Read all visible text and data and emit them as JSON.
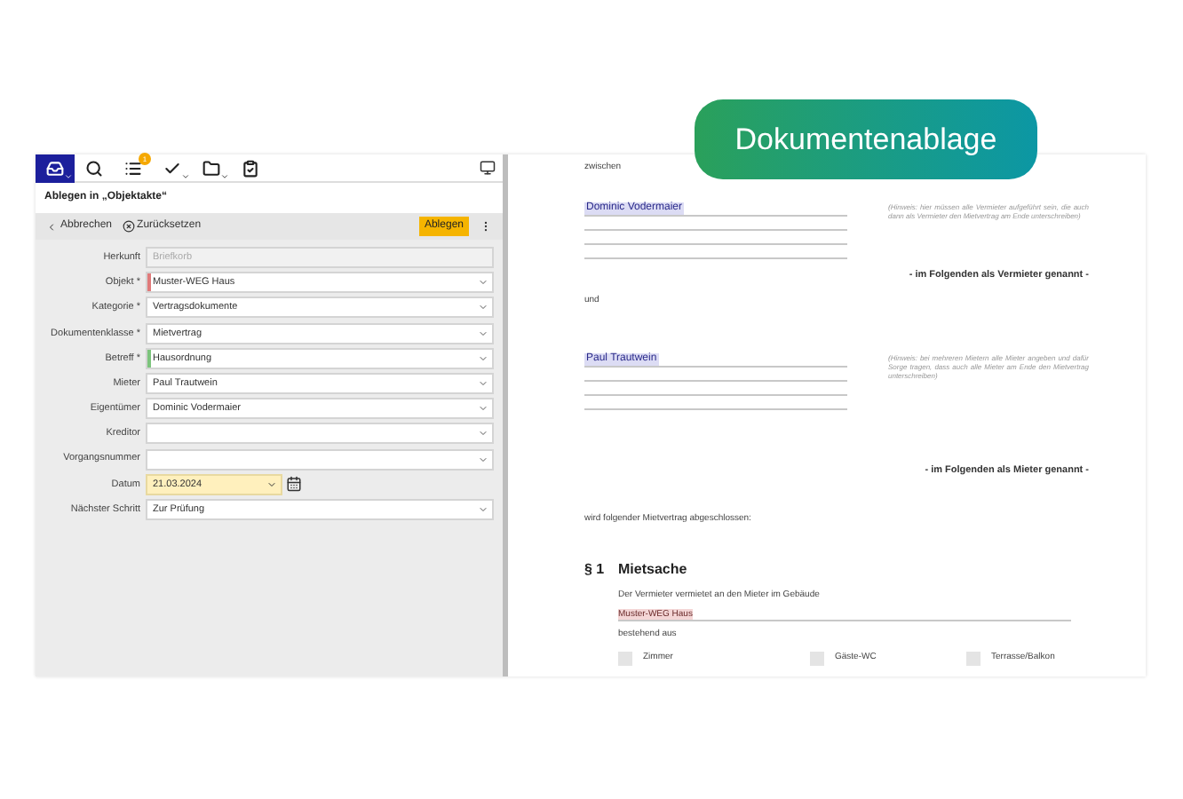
{
  "badge": "Dokumentenablage",
  "toolbar": [
    {
      "kind": "inbox",
      "selected": true,
      "caret": true
    },
    {
      "kind": "search",
      "selected": false,
      "caret": false
    },
    {
      "kind": "list",
      "selected": false,
      "caret": false,
      "count": "1"
    },
    {
      "kind": "check",
      "selected": false,
      "caret": true
    },
    {
      "kind": "folder",
      "selected": false,
      "caret": true
    },
    {
      "kind": "clipboard",
      "selected": false,
      "caret": false
    }
  ],
  "panel_title": "Ablegen in „Objektakte“",
  "actions": {
    "cancel": "Abbrechen",
    "reset": "Zurücksetzen",
    "submit": "Ablegen"
  },
  "fields": [
    {
      "label": "Herkunft",
      "kind": "readonly",
      "value": "Briefkorb"
    },
    {
      "label": "Objekt *",
      "kind": "select",
      "value": "Muster-WEG Haus",
      "color": "#e07a7a"
    },
    {
      "label": "Kategorie *",
      "kind": "select",
      "value": "Vertragsdokumente"
    },
    {
      "label": "Dokumentenklasse *",
      "kind": "select",
      "value": "Mietvertrag"
    },
    {
      "label": "Betreff *",
      "kind": "select",
      "value": "Hausordnung",
      "color": "#7cc47c"
    },
    {
      "label": "Mieter",
      "kind": "select",
      "value": "Paul Trautwein"
    },
    {
      "label": "Eigentümer",
      "kind": "select",
      "value": "Dominic Vodermaier"
    },
    {
      "label": "Kreditor",
      "kind": "select"
    },
    {
      "label": "Vorgangsnummer",
      "kind": "select"
    },
    {
      "label": "Datum",
      "kind": "date",
      "value": "21.03.2024"
    },
    {
      "label": "Nächster Schritt",
      "kind": "select",
      "value": "Zur Prüfung"
    }
  ],
  "document": {
    "between": "zwischen",
    "landlord": {
      "name": "Dominic Vodermaier",
      "hint": "(Hinweis: hier müssen alle Vermieter aufgeführt sein, die auch dann als Vermieter den Mietvertrag am Ende unterschreiben)",
      "role": "- im Folgenden als Vermieter genannt -"
    },
    "and": "und",
    "tenant": {
      "name": "Paul Trautwein",
      "hint": "(Hinweis: bei mehreren Mietern alle Mieter angeben und dafür Sorge tragen, dass auch alle Mieter am Ende den Mietvertrag unterschreiben)",
      "role": "- im Folgenden als Mieter genannt -"
    },
    "intro": "wird folgender Mietvertrag abgeschlossen:",
    "section": {
      "number": "§ 1",
      "title": "Mietsache",
      "text": "Der Vermieter vermietet an den Mieter im Gebäude",
      "building": "Muster-WEG Haus",
      "consists": "bestehend aus",
      "options": [
        {
          "label": "Zimmer",
          "checked": false
        },
        {
          "label": "Gäste-WC",
          "checked": false
        },
        {
          "label": "Terrasse/Balkon",
          "checked": false
        }
      ]
    }
  }
}
